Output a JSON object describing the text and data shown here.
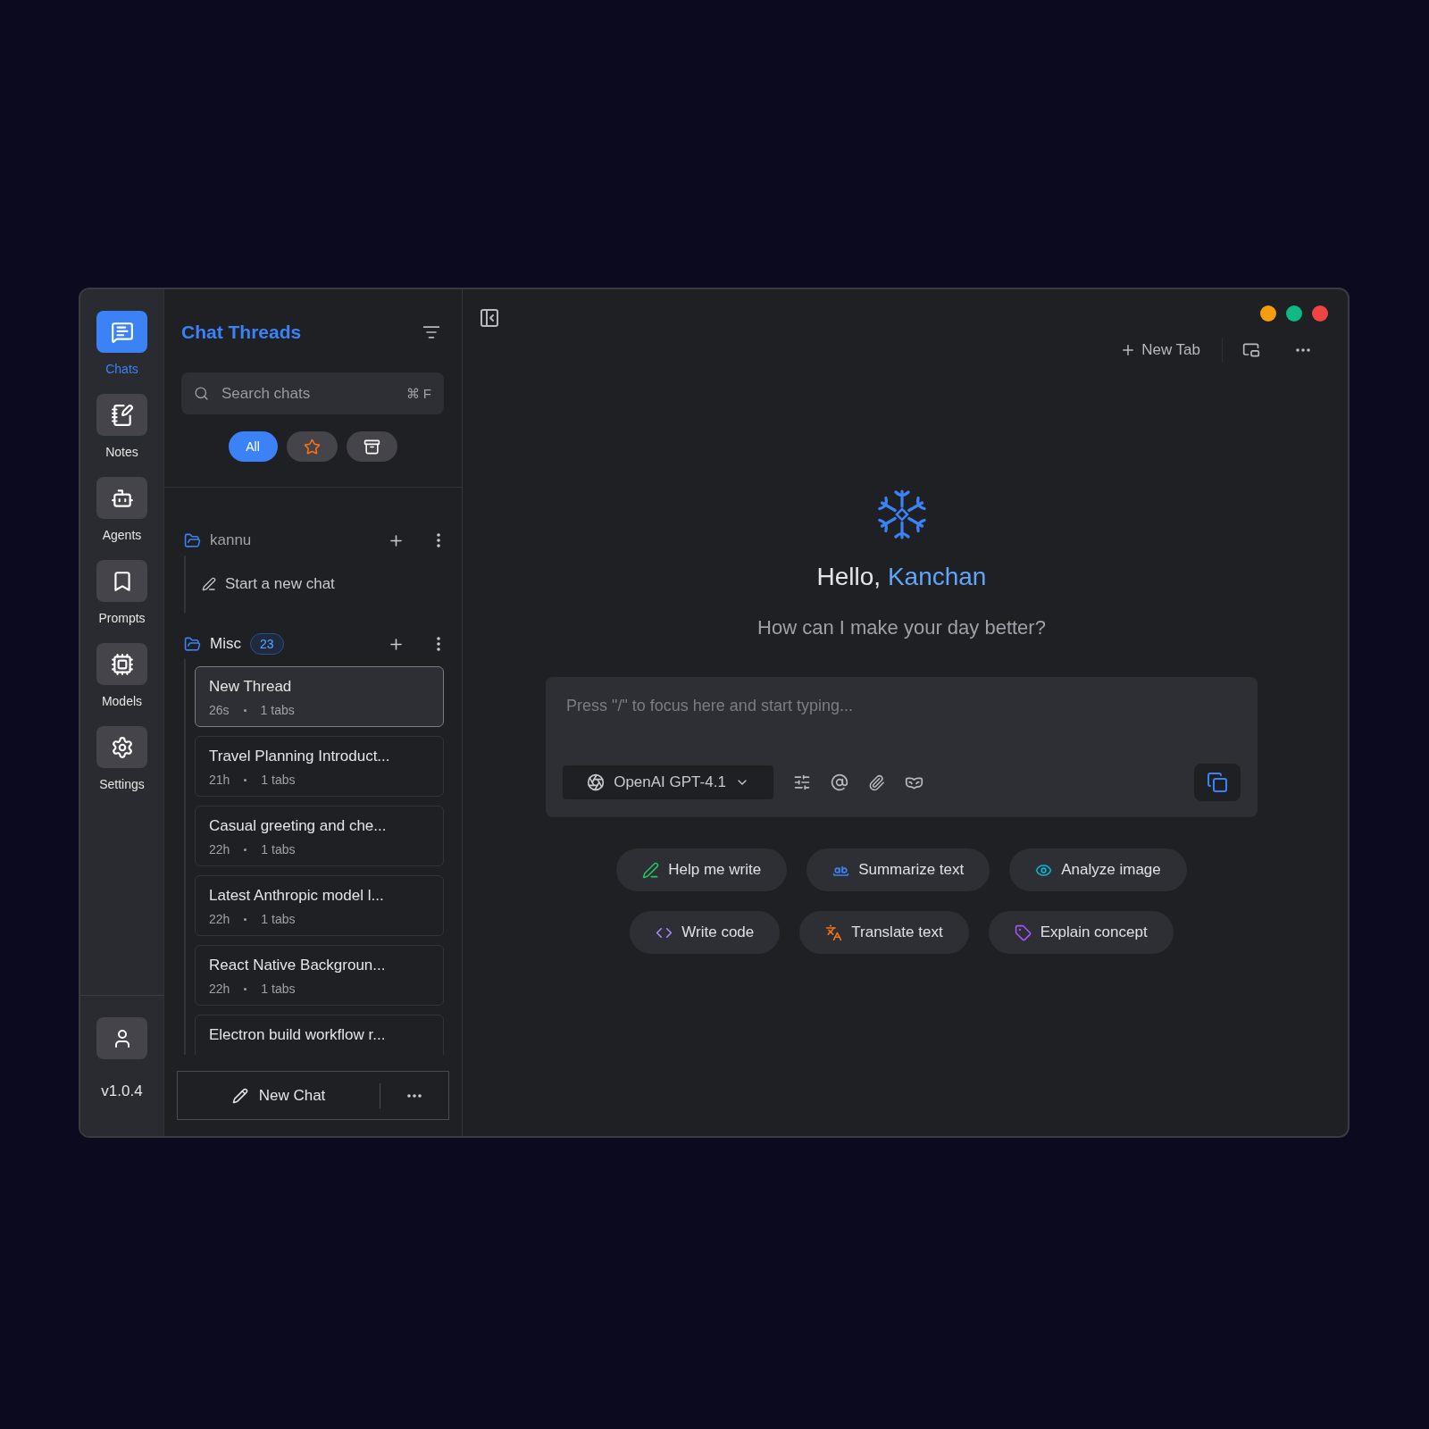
{
  "rail": {
    "items": [
      {
        "label": "Chats",
        "selected": true
      },
      {
        "label": "Notes",
        "selected": false
      },
      {
        "label": "Agents",
        "selected": false
      },
      {
        "label": "Prompts",
        "selected": false
      },
      {
        "label": "Models",
        "selected": false
      },
      {
        "label": "Settings",
        "selected": false
      }
    ],
    "version": "v1.0.4"
  },
  "threads_panel": {
    "title": "Chat Threads",
    "search": {
      "placeholder": "Search chats",
      "shortcut": "⌘ F"
    },
    "filters": [
      {
        "kind": "text",
        "label": "All",
        "selected": true
      },
      {
        "kind": "star",
        "selected": false
      },
      {
        "kind": "archive",
        "selected": false
      }
    ],
    "folders": [
      {
        "name": "kannu",
        "start_label": "Start a new chat"
      },
      {
        "name": "Misc",
        "count": "23",
        "threads": [
          {
            "title": "New Thread",
            "time": "26s",
            "tabs": "1 tabs",
            "selected": true
          },
          {
            "title": "Travel Planning Introduct...",
            "time": "21h",
            "tabs": "1 tabs",
            "selected": false
          },
          {
            "title": "Casual greeting and che...",
            "time": "22h",
            "tabs": "1 tabs",
            "selected": false
          },
          {
            "title": "Latest Anthropic model l...",
            "time": "22h",
            "tabs": "1 tabs",
            "selected": false
          },
          {
            "title": "React Native Backgroun...",
            "time": "22h",
            "tabs": "1 tabs",
            "selected": false
          },
          {
            "title": "Electron build workflow r...",
            "selected": false
          }
        ]
      }
    ],
    "new_chat_button": "New Chat"
  },
  "toolbar": {
    "new_tab": "New Tab"
  },
  "greeting": {
    "hello": "Hello,",
    "name": "Kanchan",
    "subtitle": "How can I make your day better?"
  },
  "composer": {
    "placeholder": "Press \"/\" to focus here and start typing...",
    "model": "OpenAI GPT-4.1"
  },
  "suggestions": [
    {
      "label": "Help me write",
      "color": "#22c55e"
    },
    {
      "label": "Summarize text",
      "color": "#3b82f6"
    },
    {
      "label": "Analyze image",
      "color": "#06b6d4"
    },
    {
      "label": "Write code",
      "color": "#a78bfa"
    },
    {
      "label": "Translate text",
      "color": "#f97316"
    },
    {
      "label": "Explain concept",
      "color": "#a855f7"
    }
  ]
}
